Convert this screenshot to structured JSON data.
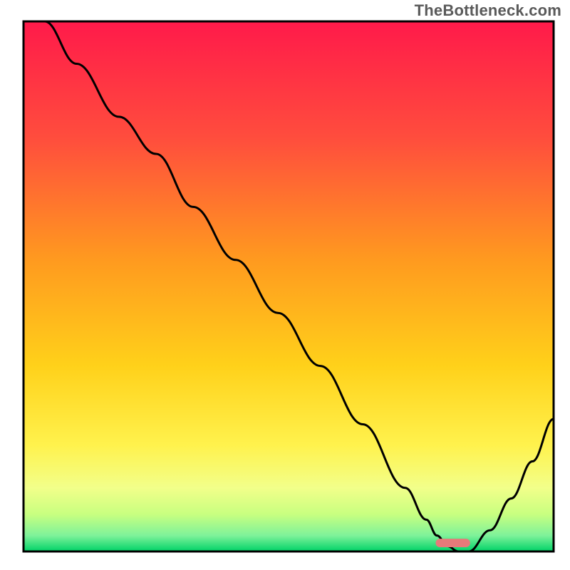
{
  "watermark": "TheBottleneck.com",
  "chart_data": {
    "type": "line",
    "title": "",
    "xlabel": "",
    "ylabel": "",
    "xlim": [
      0,
      100
    ],
    "ylim": [
      0,
      100
    ],
    "grid": false,
    "legend": false,
    "background_gradient": {
      "top": "#ff1a4a",
      "mid_upper": "#ff9a1f",
      "mid_lower": "#ffe733",
      "near_bottom": "#f7ff66",
      "lower_band": "#c8ff80",
      "bottom": "#00d267"
    },
    "series": [
      {
        "name": "bottleneck-curve",
        "stroke": "#000000",
        "x": [
          4,
          10,
          18,
          25,
          32,
          40,
          48,
          56,
          64,
          72,
          76,
          78,
          80,
          82,
          84,
          88,
          92,
          96,
          100
        ],
        "values": [
          100,
          92,
          82,
          75,
          65,
          55,
          45,
          35,
          24,
          12,
          6,
          3,
          1,
          0,
          0,
          4,
          10,
          17,
          25
        ]
      }
    ],
    "marker": {
      "name": "optimal-pill",
      "color": "#e67a7a",
      "x_center": 81,
      "y": 1.6,
      "width_pct": 6.5,
      "height_pct": 1.6
    }
  }
}
